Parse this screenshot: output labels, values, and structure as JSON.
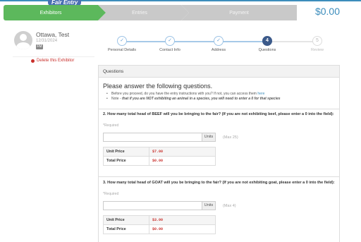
{
  "brand": "Fair Entry",
  "wizard": {
    "steps": [
      {
        "label": "Exhibitors",
        "state": "active"
      },
      {
        "label": "Entries",
        "state": "inactive"
      },
      {
        "label": "Payment",
        "state": "inactive"
      }
    ],
    "total": "$0.00"
  },
  "exhibitor": {
    "name": "Ottawa, Test",
    "date": "12/31/2024",
    "tag": "FM",
    "delete_label": "Delete this Exhibitor"
  },
  "progress": {
    "steps": [
      {
        "label": "Personal Details",
        "icon": "✓",
        "state": "done"
      },
      {
        "label": "Contact Info",
        "icon": "✓",
        "state": "done"
      },
      {
        "label": "Address",
        "icon": "✓",
        "state": "done"
      },
      {
        "label": "Questions",
        "icon": "4",
        "state": "current"
      },
      {
        "label": "Review",
        "icon": "5",
        "state": "future"
      }
    ]
  },
  "questions": {
    "panel_title": "Questions",
    "intro_title": "Please answer the following questions.",
    "note1_prefix": "Before you proceed, do you have the entry instructions with you? If not, you can access them ",
    "note1_link": "here",
    "note2_prefix": "Note - ",
    "note2_bold": "that if you are NOT exhibiting an animal in a species, you will need to enter a 0 for that species",
    "items": [
      {
        "text": "2. How many total head of BEEF will you be bringing to the fair? (If you are not exhibiting beef, please enter a 0 into the field):",
        "required": "*Required",
        "value": "",
        "units": "Units",
        "max": "(Max 25)",
        "unit_price_label": "Unit Price",
        "unit_price": "$7.00",
        "total_price_label": "Total Price",
        "total_price": "$0.00"
      },
      {
        "text": "3. How many total head of GOAT will you be bringing to the fair? (If you are not exhibiting goat, please enter a 0 into the field):",
        "required": "*Required",
        "value": "",
        "units": "Units",
        "max": "(Max 4)",
        "unit_price_label": "Unit Price",
        "unit_price": "$3.00",
        "total_price_label": "Total Price",
        "total_price": "$0.00"
      }
    ]
  }
}
